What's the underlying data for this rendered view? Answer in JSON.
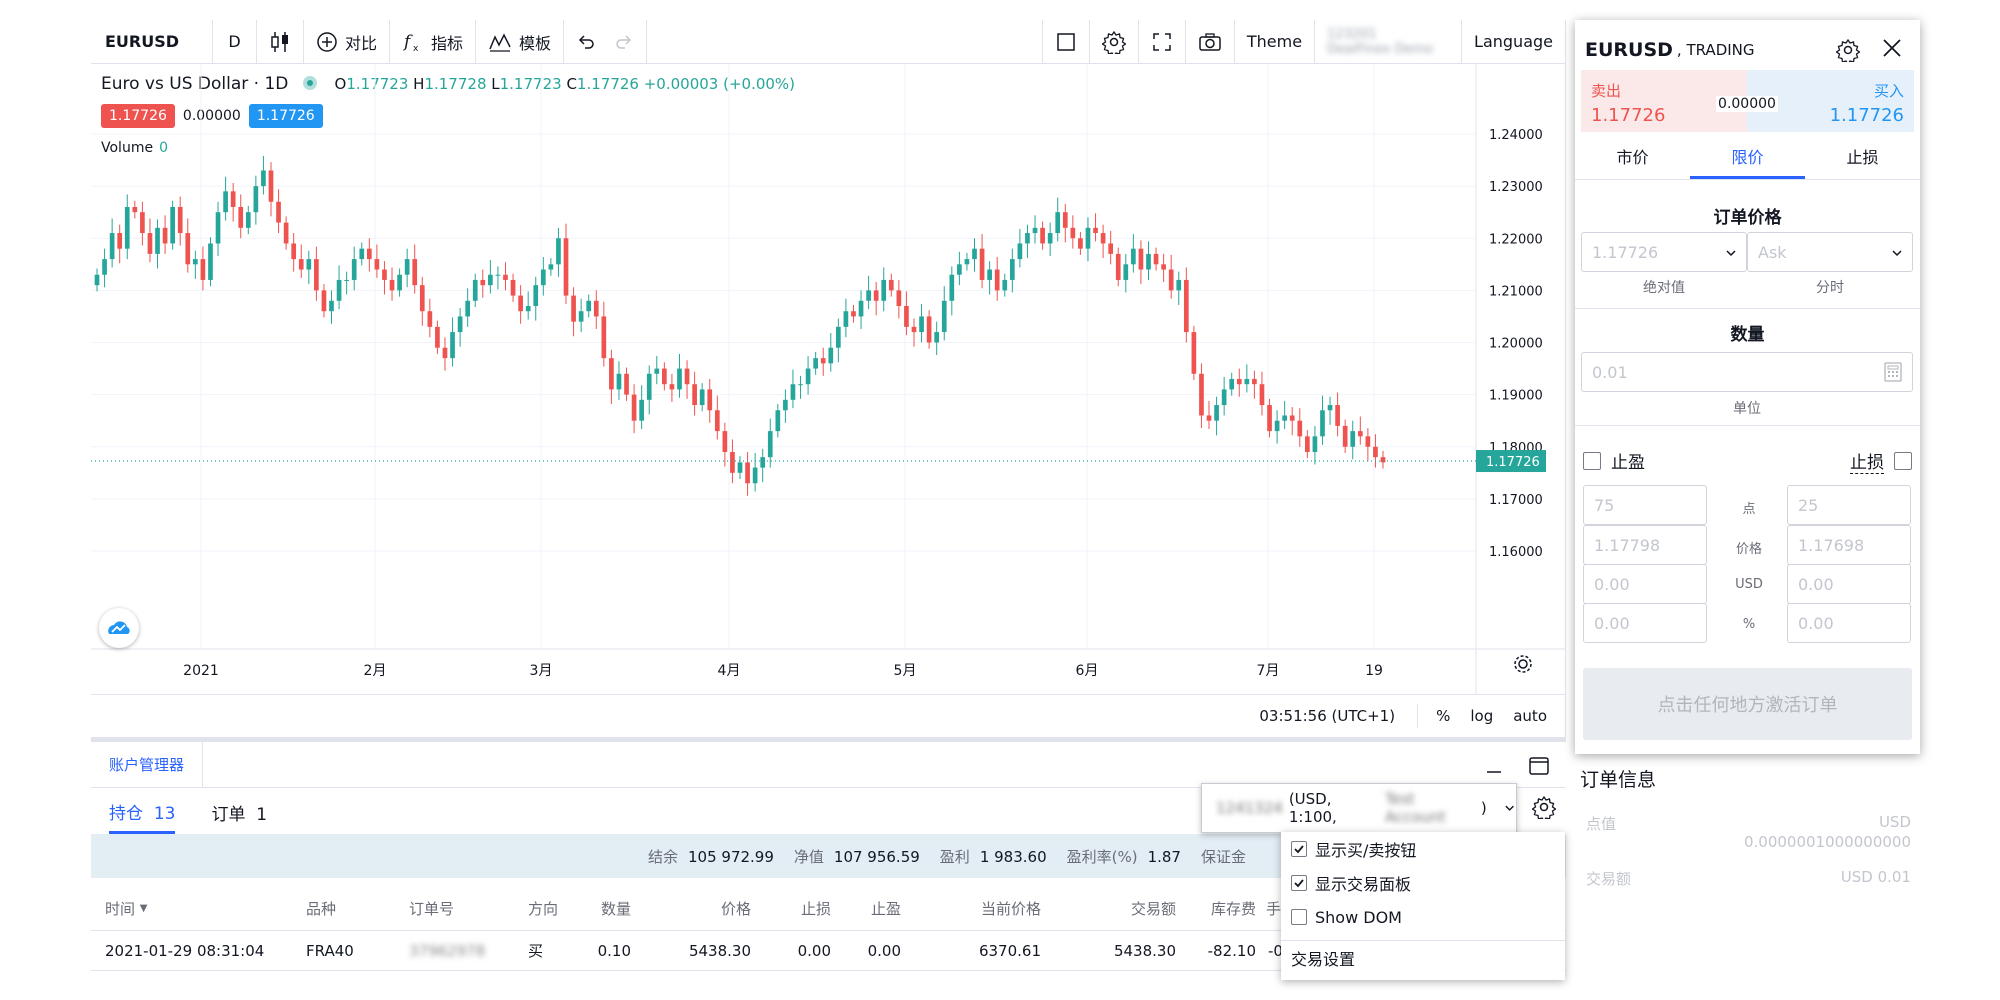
{
  "toolbar": {
    "symbol": "EURUSD",
    "interval": "D",
    "compare": "对比",
    "indicators": "指标",
    "templates": "模板",
    "theme": "Theme",
    "account_line1": "123201",
    "account_line2": "DealFinex Demo",
    "language": "Language"
  },
  "legend": {
    "title": "Euro vs US Dollar · 1D",
    "o_key": "O",
    "o": "1.17723",
    "h_key": "H",
    "h": "1.17728",
    "l_key": "L",
    "l": "1.17723",
    "c_key": "C",
    "c": "1.17726",
    "change": "+0.00003 (+0.00%)",
    "sell": "1.17726",
    "spread": "0.00000",
    "buy": "1.17726",
    "volume_label": "Volume",
    "volume_value": "0"
  },
  "colors": {
    "up": "#26a69a",
    "down": "#ef5350",
    "accent": "#2962ff",
    "buy": "#2196f3",
    "sell": "#ef5350"
  },
  "chart_data": {
    "type": "candlestick",
    "y_ticks": [
      "1.24000",
      "1.23000",
      "1.22000",
      "1.21000",
      "1.20000",
      "1.19000",
      "1.18000",
      "1.17000",
      "1.16000"
    ],
    "ylim": [
      1.16,
      1.24
    ],
    "x_ticks": [
      "2021",
      "2月",
      "3月",
      "4月",
      "5月",
      "6月",
      "7月",
      "19"
    ],
    "last_price": "1.17726",
    "last_value": 1.17726,
    "series_closes": [
      1.213,
      1.216,
      1.221,
      1.218,
      1.226,
      1.225,
      1.221,
      1.217,
      1.222,
      1.219,
      1.226,
      1.221,
      1.215,
      1.216,
      1.212,
      1.219,
      1.225,
      1.229,
      1.226,
      1.222,
      1.225,
      1.23,
      1.233,
      1.227,
      1.223,
      1.219,
      1.216,
      1.214,
      1.216,
      1.21,
      1.206,
      1.208,
      1.212,
      1.212,
      1.216,
      1.218,
      1.216,
      1.214,
      1.212,
      1.21,
      1.213,
      1.216,
      1.211,
      1.206,
      1.203,
      1.199,
      1.197,
      1.202,
      1.205,
      1.208,
      1.212,
      1.211,
      1.213,
      1.213,
      1.212,
      1.209,
      1.206,
      1.207,
      1.211,
      1.214,
      1.215,
      1.22,
      1.209,
      1.204,
      1.206,
      1.208,
      1.205,
      1.197,
      1.191,
      1.194,
      1.19,
      1.185,
      1.189,
      1.194,
      1.195,
      1.192,
      1.191,
      1.195,
      1.192,
      1.188,
      1.191,
      1.187,
      1.183,
      1.179,
      1.175,
      1.177,
      1.173,
      1.176,
      1.178,
      1.183,
      1.187,
      1.189,
      1.192,
      1.192,
      1.195,
      1.197,
      1.196,
      1.199,
      1.203,
      1.206,
      1.205,
      1.208,
      1.21,
      1.208,
      1.212,
      1.21,
      1.207,
      1.203,
      1.202,
      1.205,
      1.2,
      1.202,
      1.208,
      1.213,
      1.215,
      1.216,
      1.218,
      1.212,
      1.214,
      1.21,
      1.212,
      1.216,
      1.219,
      1.221,
      1.222,
      1.219,
      1.221,
      1.225,
      1.222,
      1.22,
      1.218,
      1.222,
      1.221,
      1.219,
      1.217,
      1.212,
      1.215,
      1.218,
      1.214,
      1.217,
      1.215,
      1.214,
      1.21,
      1.212,
      1.202,
      1.194,
      1.186,
      1.185,
      1.188,
      1.191,
      1.193,
      1.192,
      1.193,
      1.192,
      1.188,
      1.183,
      1.185,
      1.186,
      1.185,
      1.182,
      1.179,
      1.182,
      1.187,
      1.188,
      1.184,
      1.18,
      1.183,
      1.182,
      1.18,
      1.178,
      1.177
    ]
  },
  "bottom_strip": {
    "time": "03:51:56 (UTC+1)",
    "percent": "%",
    "log": "log",
    "auto": "auto"
  },
  "account_manager": {
    "tab": "账户管理器",
    "positions_label": "持仓",
    "positions_count": "13",
    "orders_label": "订单",
    "orders_count": "1",
    "summary": [
      {
        "label": "结余",
        "value": "105 972.99"
      },
      {
        "label": "净值",
        "value": "107 956.59"
      },
      {
        "label": "盈利",
        "value": "1 983.60"
      },
      {
        "label": "盈利率(%)",
        "value": "1.87"
      },
      {
        "label": "保证金",
        "value": ""
      }
    ],
    "columns": [
      "时间",
      "品种",
      "订单号",
      "方向",
      "数量",
      "价格",
      "止损",
      "止盈",
      "当前价格",
      "交易额",
      "库存费",
      "手续"
    ],
    "row": {
      "time": "2021-01-29 08:31:04",
      "symbol": "FRA40",
      "order_id": "37962978",
      "side": "买",
      "qty": "0.10",
      "price": "5438.30",
      "sl": "0.00",
      "tp": "0.00",
      "current": "6370.61",
      "amount": "5438.30",
      "swap": "-82.10",
      "fee": "-0"
    },
    "account_select_blur": "1241324",
    "account_select_text": "(USD, 1:100,",
    "account_select_blur2": "Test Account",
    "account_select_end": ")"
  },
  "context_menu": {
    "items": [
      {
        "label": "显示买/卖按钮",
        "checked": true
      },
      {
        "label": "显示交易面板",
        "checked": true
      },
      {
        "label": "Show DOM",
        "checked": false
      }
    ],
    "settings": "交易设置"
  },
  "trading_panel": {
    "symbol": "EURUSD",
    "subtitle": ", TRADING",
    "sell_label": "卖出",
    "sell_price": "1.17726",
    "spread": "0.00000",
    "buy_label": "买入",
    "buy_price": "1.17726",
    "tabs": [
      "市价",
      "限价",
      "止损"
    ],
    "order_price_title": "订单价格",
    "price_value": "1.17726",
    "price_mode": "Ask",
    "abs_caption": "绝对值",
    "tick_caption": "分时",
    "qty_title": "数量",
    "qty_value": "0.01",
    "unit_caption": "单位",
    "take_profit": "止盈",
    "stop_loss": "止损",
    "tp_points": "75",
    "sl_points": "25",
    "tp_price": "1.17798",
    "sl_price": "1.17698",
    "tp_usd": "0.00",
    "sl_usd": "0.00",
    "tp_pct": "0.00",
    "sl_pct": "0.00",
    "mid_labels": [
      "点",
      "价格",
      "USD",
      "%"
    ],
    "activate": "点击任何地方激活订单"
  },
  "order_info": {
    "title": "订单信息",
    "pip_label": "点值",
    "pip_unit": "USD",
    "pip_value": "0.0000001000000000",
    "amount_label": "交易额",
    "amount_value": "USD 0.01"
  }
}
